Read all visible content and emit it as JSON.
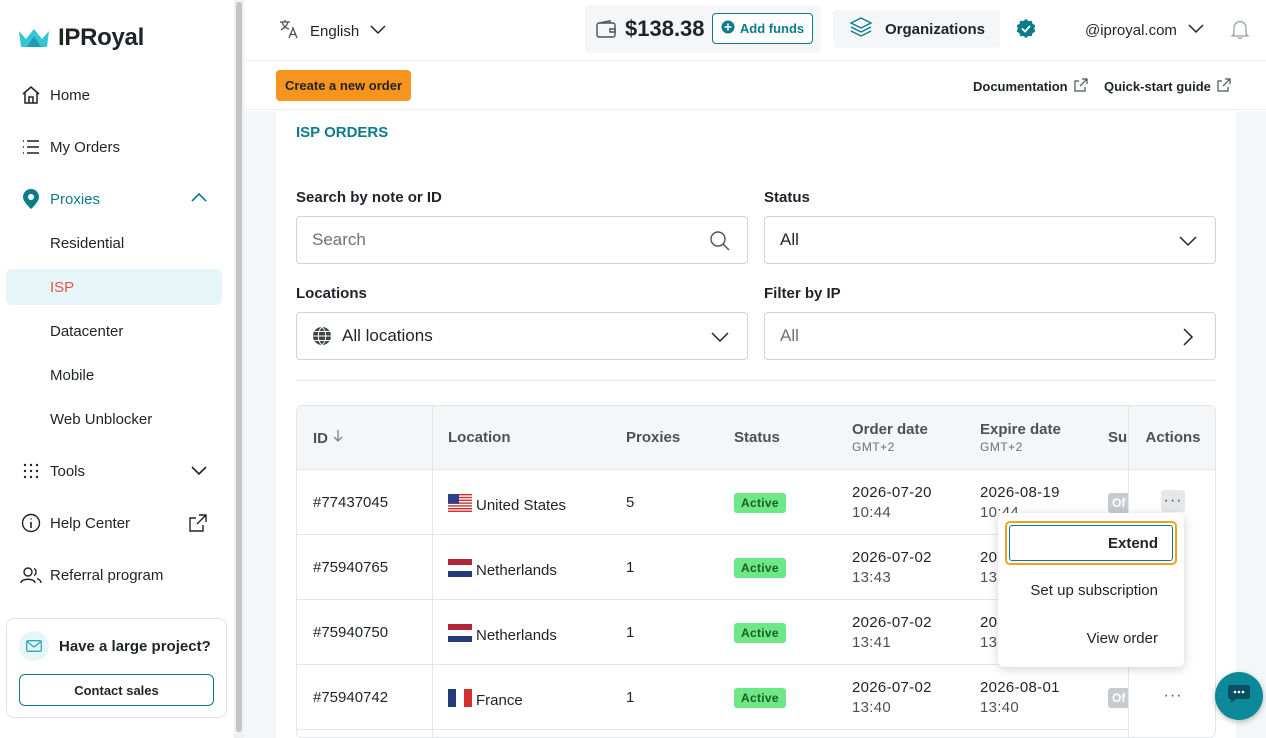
{
  "brand": {
    "name": "IPRoyal"
  },
  "sidebar": {
    "items": [
      {
        "label": "Home"
      },
      {
        "label": "My Orders"
      },
      {
        "label": "Proxies"
      },
      {
        "label": "Residential"
      },
      {
        "label": "ISP"
      },
      {
        "label": "Datacenter"
      },
      {
        "label": "Mobile"
      },
      {
        "label": "Web Unblocker"
      },
      {
        "label": "Tools"
      },
      {
        "label": "Help Center"
      },
      {
        "label": "Referral program"
      }
    ],
    "promo": {
      "title": "Have a large project?",
      "button": "Contact sales"
    }
  },
  "topbar": {
    "language": "English",
    "balance": "$138.38",
    "add_funds": "Add funds",
    "organizations": "Organizations",
    "account": "@iproyal.com"
  },
  "subbar": {
    "create": "Create a new order",
    "documentation": "Documentation",
    "quickstart": "Quick-start guide"
  },
  "page": {
    "title": "ISP ORDERS",
    "search_label": "Search by note or ID",
    "search_placeholder": "Search",
    "status_label": "Status",
    "status_value": "All",
    "locations_label": "Locations",
    "locations_value": "All locations",
    "filter_ip_label": "Filter by IP",
    "filter_ip_value": "All"
  },
  "table": {
    "headers": {
      "id": "ID",
      "location": "Location",
      "proxies": "Proxies",
      "status": "Status",
      "order_date": "Order date",
      "order_tz": "GMT+2",
      "expire_date": "Expire date",
      "expire_tz": "GMT+2",
      "sub": "Su",
      "actions": "Actions"
    },
    "rows": [
      {
        "id": "#77437045",
        "country": "United States",
        "flag": "us",
        "proxies": "5",
        "status": "Active",
        "order_date": "2026-07-20",
        "order_time": "10:44",
        "expire_date": "2026-08-19",
        "expire_time": "10:44",
        "sub": "Of"
      },
      {
        "id": "#75940765",
        "country": "Netherlands",
        "flag": "nl",
        "proxies": "1",
        "status": "Active",
        "order_date": "2026-07-02",
        "order_time": "13:43",
        "expire_date": "20",
        "expire_time": "13:",
        "sub": ""
      },
      {
        "id": "#75940750",
        "country": "Netherlands",
        "flag": "nl",
        "proxies": "1",
        "status": "Active",
        "order_date": "2026-07-02",
        "order_time": "13:41",
        "expire_date": "20",
        "expire_time": "13:",
        "sub": ""
      },
      {
        "id": "#75940742",
        "country": "France",
        "flag": "fr",
        "proxies": "1",
        "status": "Active",
        "order_date": "2026-07-02",
        "order_time": "13:40",
        "expire_date": "2026-08-01",
        "expire_time": "13:40",
        "sub": "Of"
      }
    ]
  },
  "actions_menu": {
    "items": [
      "Extend",
      "Set up subscription",
      "View order"
    ]
  },
  "colors": {
    "accent": "#0c7c8a",
    "cta": "#f7941d",
    "active_badge": "#6ee787",
    "danger_text": "#e8553f"
  }
}
